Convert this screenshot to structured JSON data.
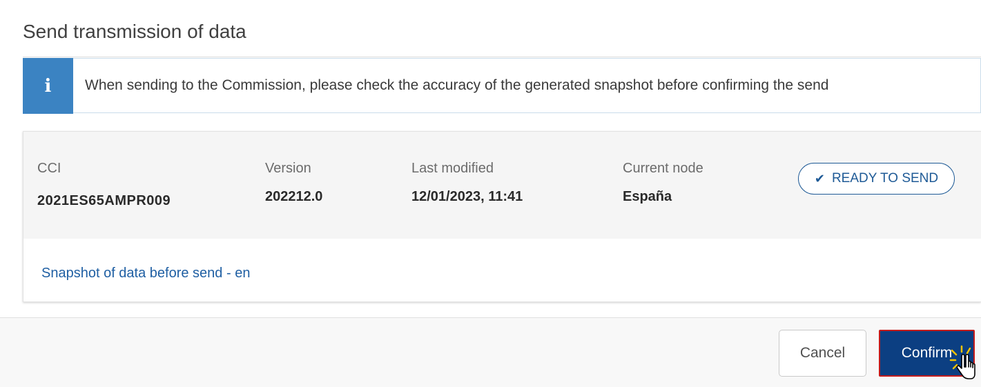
{
  "dialog": {
    "title": "Send transmission of data",
    "info_message": "When sending to the Commission, please check the accuracy of the generated snapshot before confirming the send",
    "info_icon": "i"
  },
  "record": {
    "cci_label": "CCI",
    "cci_value": "2021ES65AMPR009",
    "version_label": "Version",
    "version_value": "202212.0",
    "last_modified_label": "Last modified",
    "last_modified_value": "12/01/2023, 11:41",
    "current_node_label": "Current node",
    "current_node_value": "España",
    "status_icon": "✔",
    "status_label": "READY TO SEND"
  },
  "snapshot_link": "Snapshot of data before send - en",
  "actions": {
    "cancel_label": "Cancel",
    "confirm_label": "Confirm"
  },
  "colors": {
    "info_accent": "#3b83c2",
    "primary": "#0c3f82",
    "link": "#1f5fa3",
    "highlight_border": "#c51b1b"
  }
}
